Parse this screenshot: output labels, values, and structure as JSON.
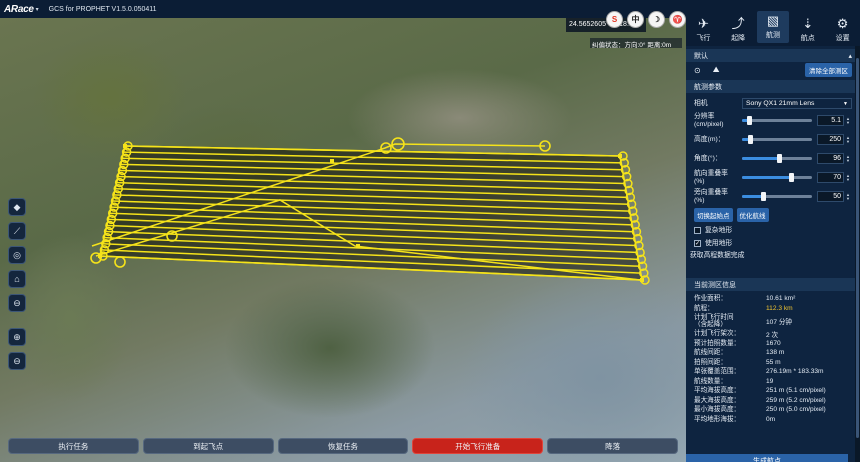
{
  "app": {
    "logo": "ARace",
    "logo_caret": "▾",
    "title": "GCS for PROPHET   V1.5.0.050411"
  },
  "map": {
    "coord_readout": "24.5652605°N 118.31",
    "status_readout": "纠偏状态：方向:0° 距离:0m",
    "lang_buttons": [
      {
        "icon": "s-logo-icon",
        "glyph": "S"
      },
      {
        "icon": "chinese-icon",
        "glyph": "中"
      },
      {
        "icon": "moon-icon",
        "glyph": "☽"
      },
      {
        "icon": "shirt-icon",
        "glyph": "♈"
      }
    ],
    "tools": [
      {
        "name": "compass-icon",
        "glyph": "◆"
      },
      {
        "name": "ruler-icon",
        "glyph": "⟋"
      },
      {
        "name": "gauge-icon",
        "glyph": "◎"
      },
      {
        "name": "home-icon",
        "glyph": "⌂"
      },
      {
        "name": "locate-icon",
        "glyph": "⊖"
      },
      {
        "name": "zoom-in-icon",
        "glyph": "⊕"
      },
      {
        "name": "zoom-out-icon",
        "glyph": "⊖"
      }
    ],
    "flight_strip_count": 19
  },
  "bottom": {
    "buttons": [
      "执行任务",
      "到起飞点",
      "恢复任务",
      "开始飞行准备",
      "降落"
    ]
  },
  "nav": {
    "items": [
      {
        "label": "飞行",
        "icon": "flight-icon",
        "glyph": "✈"
      },
      {
        "label": "起降",
        "icon": "takeoff-icon",
        "glyph": "⤴"
      },
      {
        "label": "航测",
        "icon": "survey-icon",
        "glyph": "▧"
      },
      {
        "label": "航点",
        "icon": "waypoint-icon",
        "glyph": "⇣"
      },
      {
        "label": "设置",
        "icon": "gear-icon",
        "glyph": "⚙"
      }
    ],
    "active": 2
  },
  "panel": {
    "default_label": "默认",
    "clear_label": "清除全部测区",
    "params_header": "航测参数",
    "camera_label": "相机",
    "camera_value": "Sony QX1 21mm Lens",
    "sliders": [
      {
        "label": "分辨率\n(cm/pixel)",
        "value": "5.1",
        "fraction": 0.1
      },
      {
        "label": "高度(m)：",
        "value": "250",
        "fraction": 0.12
      },
      {
        "label": "角度(°)：",
        "value": "96",
        "fraction": 0.53
      },
      {
        "label": "航向重叠率\n(%)",
        "value": "70",
        "fraction": 0.7
      },
      {
        "label": "旁向重叠率\n(%)",
        "value": "50",
        "fraction": 0.3
      }
    ],
    "switch_start_label": "切换起始点",
    "optimize_label": "优化航线",
    "complex_terrain_label": "复杂地形",
    "complex_terrain_checked": false,
    "use_terrain_label": "使用地形",
    "use_terrain_checked": true,
    "elevation_status": "获取高程数据完成",
    "info_header": "当前测区信息",
    "info": [
      {
        "k": "作业面积：",
        "v": "10.61 km²"
      },
      {
        "k": "航程：",
        "v": "112.3 km",
        "highlight": true
      },
      {
        "k": "计划飞行时间\n（含起降）",
        "v": "107 分钟"
      },
      {
        "k": "计划飞行架次：",
        "v": "2 次"
      },
      {
        "k": "预计拍照数量：",
        "v": "1670"
      },
      {
        "k": "航线间距：",
        "v": "138 m"
      },
      {
        "k": "拍照间距：",
        "v": "55 m"
      },
      {
        "k": "单张覆盖范围：",
        "v": "276.19m * 183.33m"
      },
      {
        "k": "航线数量：",
        "v": "19"
      },
      {
        "k": "平均海拔高度：",
        "v": "251 m (5.1 cm/pixel)"
      },
      {
        "k": "最大海拔高度：",
        "v": "259 m (5.2 cm/pixel)"
      },
      {
        "k": "最小海拔高度：",
        "v": "250 m (5.0 cm/pixel)"
      },
      {
        "k": "平均地形海拔：",
        "v": "0m"
      }
    ],
    "generate_label": "生成航点"
  }
}
